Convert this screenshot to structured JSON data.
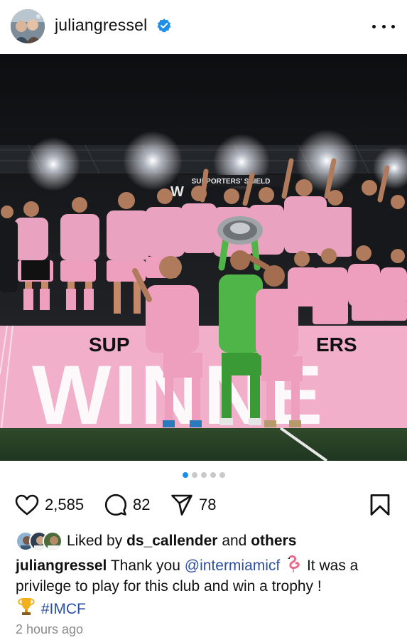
{
  "header": {
    "username": "juliangressel",
    "verified": true,
    "avatar_icon": "profile-avatar",
    "more_icon": "more-horizontal-icon"
  },
  "photo": {
    "banner_top": "SUPPORTERS' SHIELD",
    "banner_partial": "W",
    "banner_main_line1": "SUP",
    "banner_main_line1_end": "ERS",
    "banner_main_line2": "WINNE"
  },
  "carousel": {
    "count": 5,
    "active_index": 0
  },
  "actions": {
    "likes": "2,585",
    "comments": "82",
    "shares": "78"
  },
  "liked_by": {
    "prefix": "Liked by",
    "user": "ds_callender",
    "and": "and",
    "others": "others"
  },
  "caption": {
    "username": "juliangressel",
    "text1": "Thank you",
    "mention": "@intermiamicf",
    "text2": "It was a privilege to play for this club and win a trophy !",
    "hashtag": "#IMCF",
    "emojis": [
      "flamingo",
      "trophy"
    ]
  },
  "timestamp": "2 hours ago",
  "colors": {
    "accent_link": "#2d4fa1",
    "verified_blue": "#1d8fe8",
    "jersey_pink": "#f2a7c3",
    "keeper_green": "#4fb548"
  }
}
